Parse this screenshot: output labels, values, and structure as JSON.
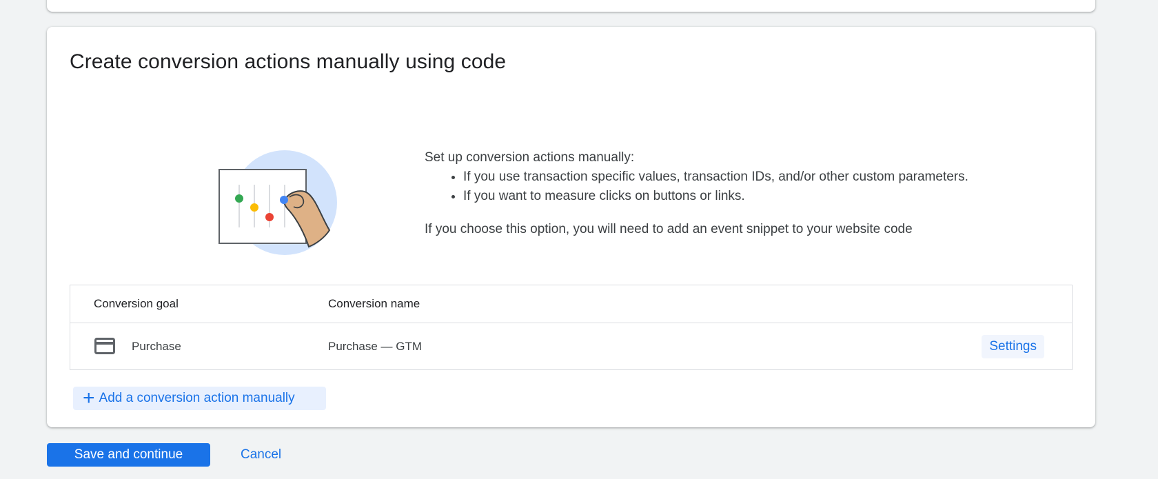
{
  "section": {
    "title": "Create conversion actions manually using code",
    "intro": "Set up conversion actions manually:",
    "bullets": [
      "If you use transaction specific values, transaction IDs, and/or other custom parameters.",
      "If you want to measure clicks on buttons or links."
    ],
    "note": "If you choose this option, you will need to add an event snippet to your website code"
  },
  "table": {
    "headers": [
      "Conversion goal",
      "Conversion name"
    ],
    "rows": [
      {
        "goal_icon": "credit-card-icon",
        "goal": "Purchase",
        "name": "Purchase — GTM",
        "action": "Settings"
      }
    ]
  },
  "add_button": {
    "icon": "plus-icon",
    "label": "Add a conversion action manually"
  },
  "footer": {
    "save_label": "Save and continue",
    "cancel_label": "Cancel"
  },
  "colors": {
    "primary": "#1a73e8",
    "background": "#f1f3f4",
    "green": "#34a853",
    "yellow": "#fbbc04",
    "red": "#ea4335",
    "blue": "#4285f4"
  }
}
